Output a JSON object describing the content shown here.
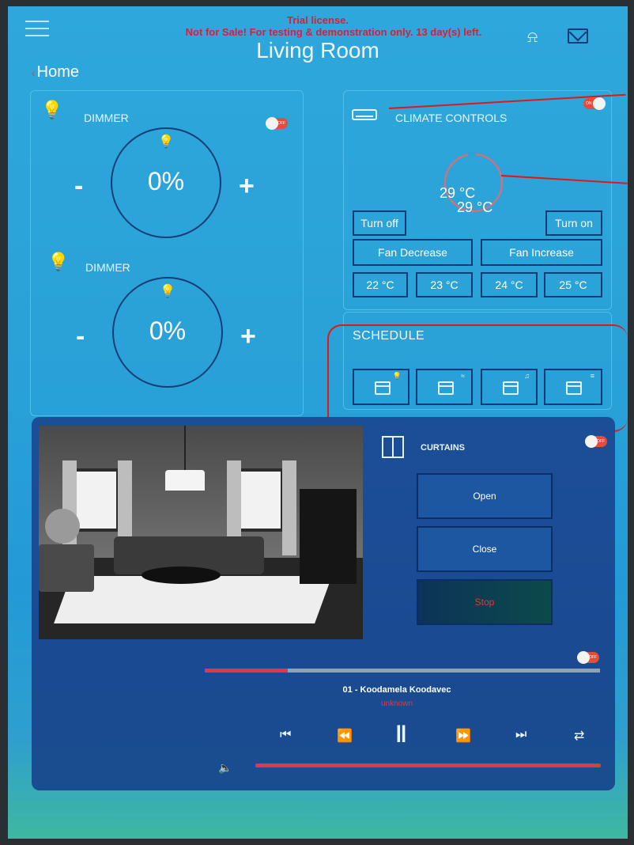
{
  "header": {
    "title": "Living Room",
    "trial_line1": "Trial license.",
    "trial_line2": "Not for Sale! For testing & demonstration only. 13 day(s) left.",
    "bell_icon": "⍾",
    "back_chevron": "‹",
    "breadcrumb": "Home"
  },
  "dimmers": [
    {
      "label": "DIMMER",
      "value": "0%",
      "minus": "-",
      "plus": "+",
      "toggle_text": "OFF"
    },
    {
      "label": "DIMMER",
      "value": "0%",
      "minus": "-",
      "plus": "+"
    }
  ],
  "icons": {
    "bulb": "💡",
    "music": "♫",
    "wind": "≈",
    "grid": "≡"
  },
  "climate": {
    "label": "CLIMATE CONTROLS",
    "toggle_text": "ON",
    "temp_current": "29 °C",
    "temp_set": "29 °C",
    "turn_off": "Turn off",
    "turn_on": "Turn on",
    "fan_decrease": "Fan Decrease",
    "fan_increase": "Fan Increase",
    "presets": [
      "22 °C",
      "23 °C",
      "24 °C",
      "25 °C"
    ]
  },
  "schedule": {
    "label": "SCHEDULE"
  },
  "curtains": {
    "label": "CURTAINS",
    "toggle_text": "OFF",
    "open": "Open",
    "close": "Close",
    "stop": "Stop"
  },
  "media": {
    "toggle_text": "OFF",
    "track": "01 - Koodamela Koodavec",
    "artist": "unknown",
    "progress": 0.21,
    "controls": {
      "prev": "⏮",
      "rewind": "⏪",
      "pause": "‖",
      "forward": "⏩",
      "next": "⏭",
      "repeat": "⇄",
      "volume": "🔈"
    }
  },
  "colors": {
    "accent_red": "#e0393e",
    "panel_border": "#4cc0ea",
    "button_border": "#0d3c78",
    "annotation": "#e01818"
  }
}
